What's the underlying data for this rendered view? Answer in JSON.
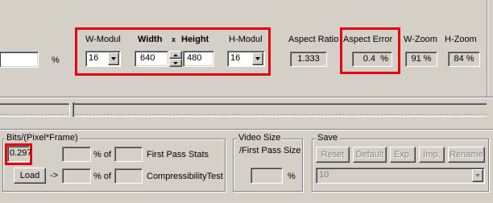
{
  "top": {
    "unnamed_field_value": "",
    "pct_symbol": "%",
    "w_modul_label": "W-Modul",
    "w_modul_value": "16",
    "width_label": "Width",
    "x_label": "x",
    "height_label": "Height",
    "width_value": "640",
    "height_value": "480",
    "h_modul_label": "H-Modul",
    "h_modul_value": "16",
    "aspect_ratio_label": "Aspect Ratio",
    "aspect_ratio_value": "1.333",
    "aspect_error_label": "Aspect Error",
    "aspect_error_value": "0.4",
    "aspect_error_unit": "%",
    "w_zoom_label": "W-Zoom",
    "w_zoom_value": "91 %",
    "h_zoom_label": "H-Zoom",
    "h_zoom_value": "84 %"
  },
  "bits": {
    "group_title": "Bits/(Pixel*Frame)",
    "bpp_value": "0.297",
    "field1_value": "",
    "pct_of_label_1": "% of",
    "field2_value": "",
    "first_pass_label": "First Pass Stats",
    "load_label": "Load",
    "arrow_label": "->",
    "field3_value": "",
    "pct_of_label_2": "% of",
    "field4_value": "",
    "compress_label": "CompressibilityTest"
  },
  "video": {
    "title_line1": "Video Size",
    "title_line2": "/First Pass Size",
    "value": "",
    "pct": "%"
  },
  "save": {
    "group_title": "Save",
    "reset_label": "Reset",
    "default_label": "Default",
    "exp_label": "Exp.",
    "imp_label": "Imp.",
    "rename_label": "Rename",
    "preset_value": "10"
  },
  "colors": {
    "highlight_red": "#e3000f",
    "face": "#d4d0c8"
  }
}
